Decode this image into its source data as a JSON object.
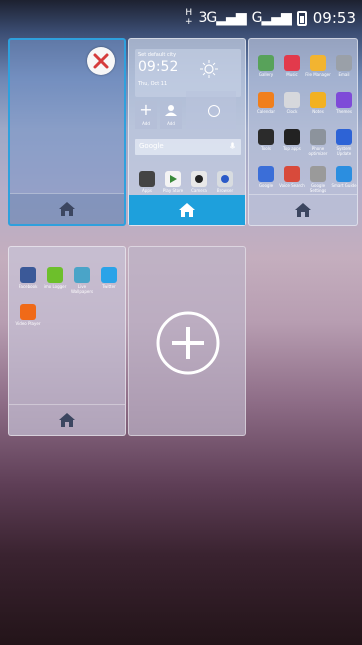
{
  "status_bar": {
    "net_top": "H",
    "net_bottom": "+",
    "signal1": "3G",
    "signal2": "G",
    "time": "09:53"
  },
  "clock_widget": {
    "city": "Set default city",
    "time": "09:52",
    "date": "Thu, Oct 11",
    "add1": "Add",
    "add2": "Add"
  },
  "search": {
    "placeholder": "Google"
  },
  "screen1_dock": [
    "Apps",
    "Play Store",
    "Camera",
    "Browser"
  ],
  "screen2_apps": [
    {
      "label": "Gallery",
      "color": "#58a25a"
    },
    {
      "label": "Music",
      "color": "#e23a4c"
    },
    {
      "label": "File Manager",
      "color": "#f2b430"
    },
    {
      "label": "Email",
      "color": "#9aa0a8"
    },
    {
      "label": "Calendar",
      "color": "#f07f1c"
    },
    {
      "label": "Clock",
      "color": "#d6d8dc"
    },
    {
      "label": "Notes",
      "color": "#f2b122"
    },
    {
      "label": "Themes",
      "color": "#7e4bd8"
    },
    {
      "label": "Tools",
      "color": "#2b2b2b"
    },
    {
      "label": "Top apps",
      "color": "#222222"
    },
    {
      "label": "Phone optimizer",
      "color": "#8c939c"
    },
    {
      "label": "System Update",
      "color": "#2d63d6"
    },
    {
      "label": "Google",
      "color": "#3b6ed8"
    },
    {
      "label": "Voice Search",
      "color": "#d84a3b"
    },
    {
      "label": "Google Settings",
      "color": "#9a9a9a"
    },
    {
      "label": "Smart Guide",
      "color": "#2b8ee0"
    }
  ],
  "screen3_apps": [
    {
      "label": "Facebook",
      "color": "#3b5998"
    },
    {
      "label": "imo Logger",
      "color": "#6dbf2b"
    },
    {
      "label": "Live Wallpapers",
      "color": "#4aa4c8"
    },
    {
      "label": "Twitter",
      "color": "#2aa3e8"
    },
    {
      "label": "Video Player",
      "color": "#f06a18"
    }
  ]
}
